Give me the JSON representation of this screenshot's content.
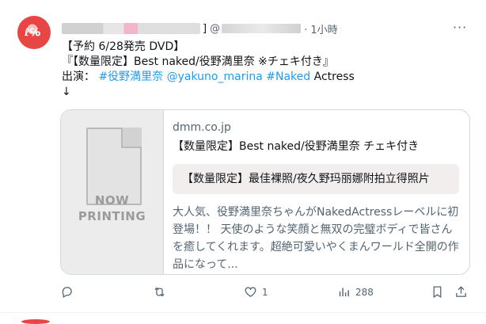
{
  "tweet": {
    "handle_prefix": "@",
    "time": "· 1小時",
    "bracket": "]",
    "more": "···",
    "lines": [
      "【予約 6/28発売 DVD】",
      "『【数量限定】Best naked/役野満里奈 ※チェキ付き』"
    ],
    "cast_label": "出演：",
    "tags": [
      "#役野満里奈",
      "@yakuno_marina",
      "#Naked"
    ],
    "cast_tail": "Actress",
    "arrow": "↓"
  },
  "card": {
    "thumb_text_1": "NOW",
    "thumb_text_2": "PRINTING",
    "domain": "dmm.co.jp",
    "title": "【数量限定】Best naked/役野満里奈 チェキ付き",
    "quote": "【数量限定】最佳裸照/夜久野玛丽娜附拍立得照片",
    "description": "大人気、役野満里奈ちゃんがNakedActressレーベルに初登場！！ 天使のような笑顔と無双の完璧ボディで皆さんを癒してくれます。超絶可愛いやくまんワールド全開の作品になって..."
  },
  "actions": {
    "likes": "1",
    "views": "288"
  },
  "icons": [
    "reply-icon",
    "retweet-icon",
    "heart-icon",
    "views-icon",
    "bookmark-icon",
    "share-icon"
  ],
  "colors": {
    "link": "#1d9bf0",
    "muted": "#536471",
    "text": "#0f1419",
    "avatar": "#e84545"
  }
}
